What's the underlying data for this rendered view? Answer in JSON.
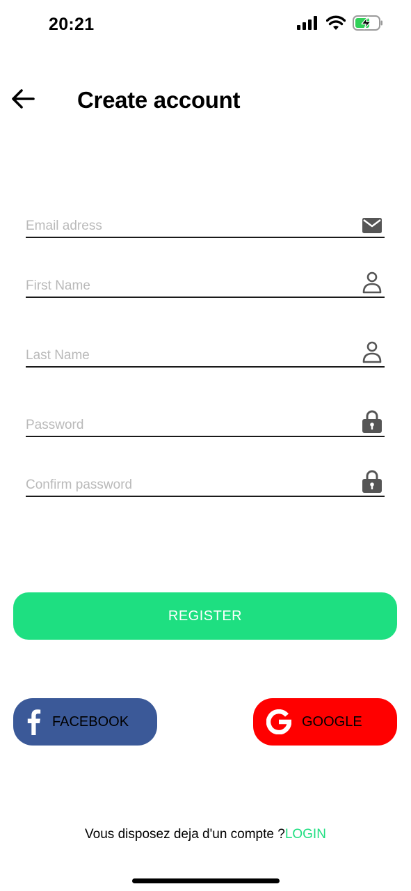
{
  "status_bar": {
    "time": "20:21",
    "icons": [
      "cellular-signal-icon",
      "wifi-icon",
      "battery-charging-icon"
    ],
    "battery_color": "#30d158"
  },
  "header": {
    "back_icon": "arrow-left-icon",
    "title": "Create account"
  },
  "form": {
    "email": {
      "placeholder": "Email adress",
      "value": "",
      "icon": "envelope-icon"
    },
    "first_name": {
      "placeholder": "First Name",
      "value": "",
      "icon": "person-icon"
    },
    "last_name": {
      "placeholder": "Last Name",
      "value": "",
      "icon": "person-icon"
    },
    "password": {
      "placeholder": "Password",
      "value": "",
      "icon": "lock-icon"
    },
    "confirm_password": {
      "placeholder": "Confirm password",
      "value": "",
      "icon": "lock-icon"
    }
  },
  "actions": {
    "register_label": "REGISTER",
    "register_color": "#1edf81",
    "facebook_label": "FACEBOOK",
    "facebook_color": "#3b5998",
    "facebook_icon": "facebook-f-icon",
    "google_label": "GOOGLE",
    "google_color": "#ff0000",
    "google_icon": "google-g-icon"
  },
  "footer": {
    "prompt": "Vous disposez deja d'un compte ?",
    "login_label": "LOGIN",
    "login_color": "#1edf81"
  }
}
